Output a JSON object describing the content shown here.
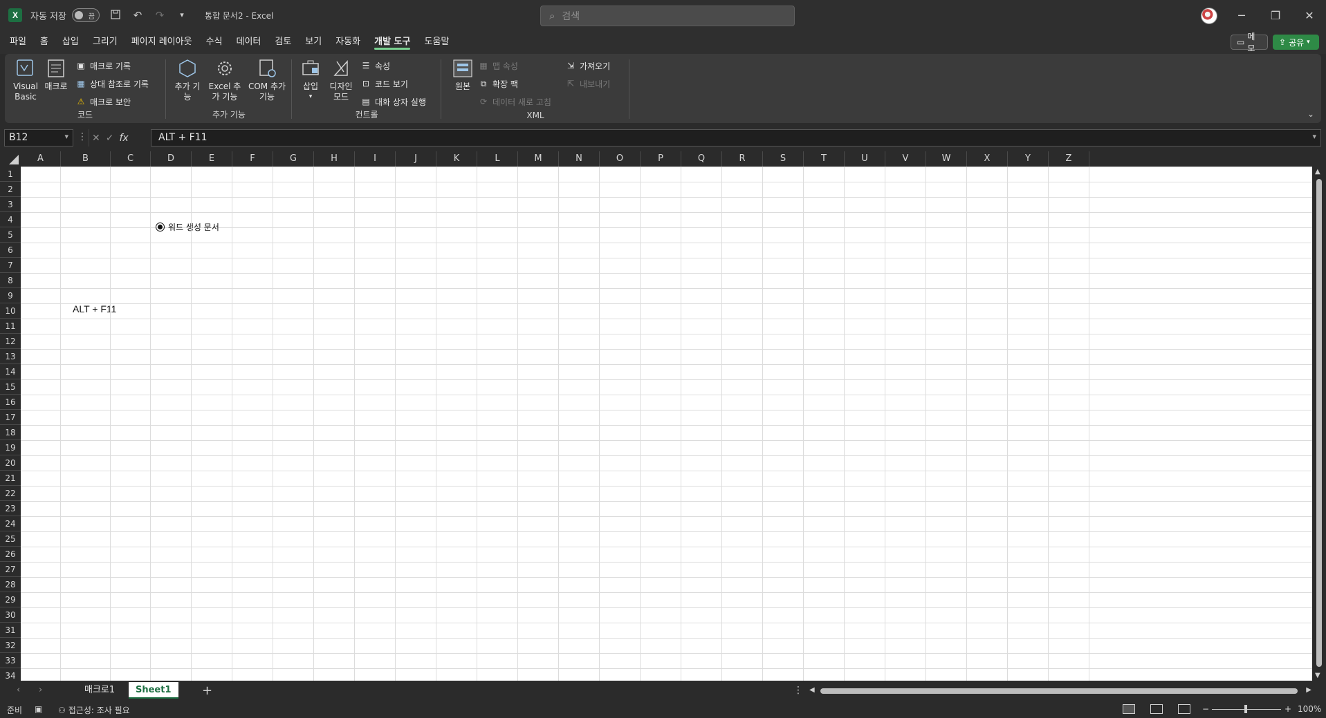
{
  "titlebar": {
    "app_icon": "excel-icon",
    "autosave_label": "자동 저장",
    "autosave_state": "끔",
    "document_title": "통합 문서2  -  Excel",
    "search_placeholder": "검색",
    "minimize": "─",
    "restore": "❐",
    "close": "✕"
  },
  "menu": {
    "tabs": [
      "파일",
      "홈",
      "삽입",
      "그리기",
      "페이지 레이아웃",
      "수식",
      "데이터",
      "검토",
      "보기",
      "자동화",
      "개발 도구",
      "도움말"
    ],
    "active_tab": "개발 도구",
    "memo_label": "메모",
    "share_label": "공유"
  },
  "ribbon": {
    "code": {
      "label": "코드",
      "visual_basic": "Visual Basic",
      "macro": "매크로",
      "record_macro": "매크로 기록",
      "relative_ref": "상대 참조로 기록",
      "macro_security": "매크로 보안"
    },
    "addins": {
      "label": "추가 기능",
      "addins": "추가 기능",
      "excel_addins": "Excel 추가 기능",
      "com_addins": "COM 추가 기능"
    },
    "controls": {
      "label": "컨트롤",
      "insert": "삽입",
      "design_mode": "디자인 모드",
      "properties": "속성",
      "view_code": "코드 보기",
      "run_dialog": "대화 상자 실행"
    },
    "xml": {
      "label": "XML",
      "source": "원본",
      "map_properties": "맵 속성",
      "expansion_packs": "확장 팩",
      "refresh_data": "데이터 새로 고침",
      "import": "가져오기",
      "export": "내보내기"
    }
  },
  "formula_bar": {
    "name_box": "B12",
    "formula": "ALT + F11",
    "fx": "fx"
  },
  "grid": {
    "columns": [
      "A",
      "B",
      "C",
      "D",
      "E",
      "F",
      "G",
      "H",
      "I",
      "J",
      "K",
      "L",
      "M",
      "N",
      "O",
      "P",
      "Q",
      "R",
      "S",
      "T",
      "U",
      "V",
      "W",
      "X",
      "Y",
      "Z"
    ],
    "rows": [
      "1",
      "2",
      "3",
      "4",
      "5",
      "6",
      "7",
      "8",
      "9",
      "10",
      "11",
      "12",
      "13",
      "14",
      "15",
      "16",
      "17",
      "18",
      "19",
      "20",
      "21",
      "22",
      "23",
      "24",
      "25",
      "26",
      "27",
      "28",
      "29",
      "30",
      "31",
      "32",
      "33",
      "34"
    ],
    "cell_b12": "ALT + F11",
    "radio_label": "워드 생성 문서"
  },
  "sheets": {
    "tabs": [
      "매크로1",
      "Sheet1"
    ],
    "active": "Sheet1",
    "add": "+"
  },
  "status": {
    "ready": "준비",
    "accessibility": "접근성: 조사 필요",
    "zoom": "100%",
    "zoom_minus": "−",
    "zoom_plus": "+"
  }
}
